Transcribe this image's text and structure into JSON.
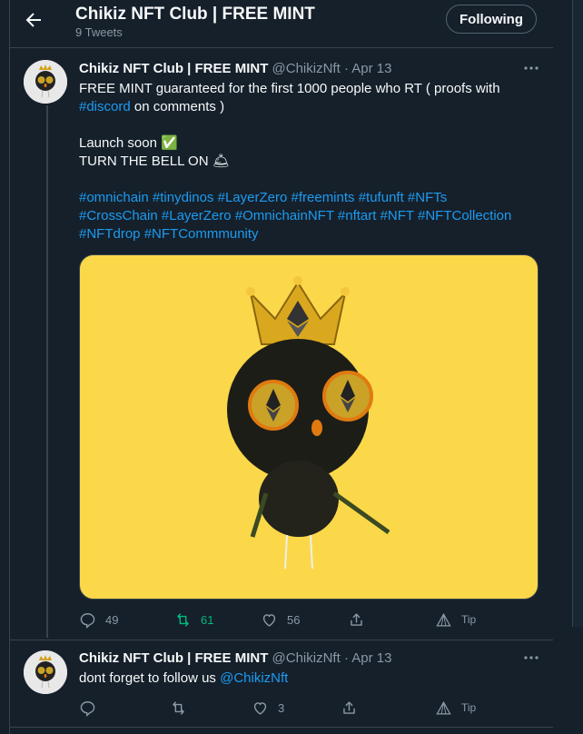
{
  "header": {
    "title": "Chikiz NFT Club | FREE MINT",
    "tweet_count": "9 Tweets",
    "follow_label": "Following"
  },
  "tweets": [
    {
      "name": "Chikiz NFT Club | FREE MINT",
      "handle": "@ChikizNft",
      "sep": "·",
      "date": "Apr 13",
      "text": {
        "line1": "FREE MINT guaranteed for the first 1000 people who RT ( proofs with",
        "hashtag_discord": "#discord",
        "line2_rest": " on comments )",
        "line3": "Launch soon ✅",
        "line4": "TURN THE BELL ON 🛎",
        "hashtags_row1": [
          "#omnichain",
          "#tinydinos",
          "#LayerZero",
          "#freemints",
          "#tufunft",
          "#NFTs"
        ],
        "hashtags_row2": [
          "#CrossChain",
          "#LayerZero",
          "#OmnichainNFT",
          "#nftart",
          "#NFT",
          "#NFTCollection"
        ],
        "hashtags_row3": [
          "#NFTdrop",
          "#NFTCommmunity"
        ]
      },
      "replies": "49",
      "retweets": "61",
      "likes": "56",
      "tip": "Tip"
    },
    {
      "name": "Chikiz NFT Club | FREE MINT",
      "handle": "@ChikizNft",
      "sep": "·",
      "date": "Apr 13",
      "text_prefix": "dont forget to follow us ",
      "mention": "@ChikizNft",
      "replies": "",
      "retweets": "",
      "likes": "3",
      "tip": "Tip"
    }
  ],
  "colors": {
    "background": "#15202b",
    "link": "#1d9bf0",
    "retweet_active": "#00ba7c",
    "muted": "#8b98a5",
    "media_bg": "#fbd849"
  }
}
